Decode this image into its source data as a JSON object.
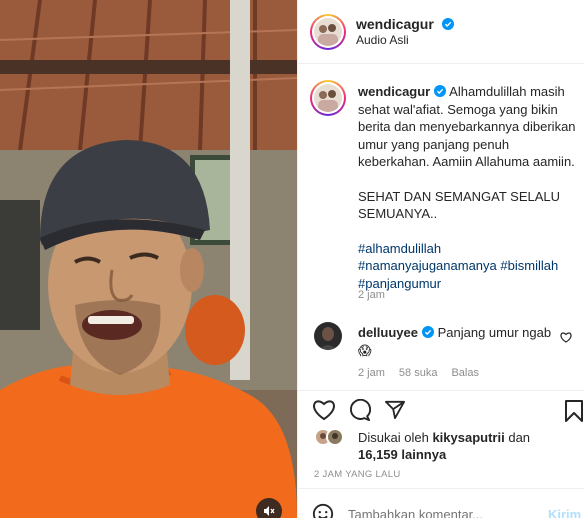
{
  "header": {
    "username": "wendicagur",
    "subtitle": "Audio Asli"
  },
  "caption": {
    "username": "wendicagur",
    "line1": "Alhamdulillah masih sehat wal'afiat. Semoga yang bikin berita dan menyebarkannya diberikan umur yang panjang penuh keberkahan. Aamiin Allahuma aamiin.",
    "line2": "SEHAT DAN SEMANGAT SELALU SEMUANYA..",
    "hashtags": [
      "#alhamdulillah",
      "#namanyajuganamanya",
      "#bismillah",
      "#panjangumur"
    ],
    "time": "2 jam"
  },
  "comment": {
    "username": "delluuyee",
    "text": "Panjang umur ngab",
    "emoji": "😱",
    "time": "2 jam",
    "likes": "58 suka",
    "reply_label": "Balas"
  },
  "likes": {
    "prefix": "Disukai oleh",
    "user": "kikysaputrii",
    "and": "dan",
    "count": "16,159 lainnya"
  },
  "post_time": "2 JAM YANG LALU",
  "add_comment": {
    "placeholder": "Tambahkan komentar...",
    "send_label": "Kirim"
  },
  "icons": {
    "verified": "verified-badge-icon",
    "like": "heart-icon",
    "comment": "comment-icon",
    "share": "share-icon",
    "save": "bookmark-icon",
    "mute": "muted-speaker-icon",
    "emoji": "emoji-icon"
  },
  "colors": {
    "verified_blue": "#0095f6",
    "hashtag": "#00376b",
    "muted_text": "#8e8e8e"
  }
}
